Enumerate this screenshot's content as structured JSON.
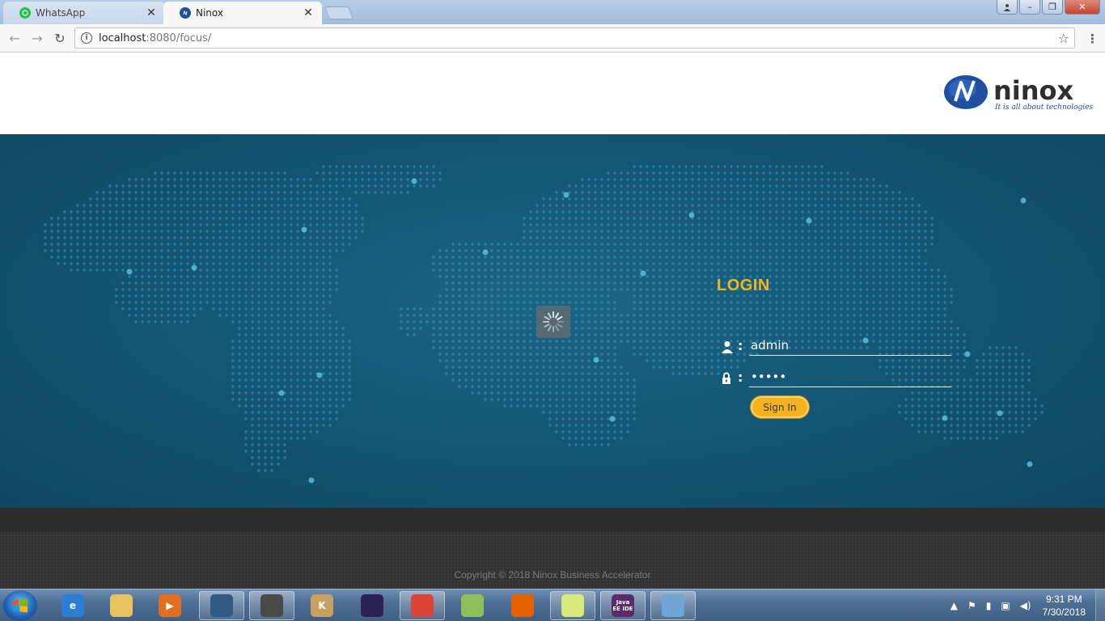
{
  "browser": {
    "tabs": [
      {
        "title": "WhatsApp",
        "active": false,
        "icon": "whatsapp-icon"
      },
      {
        "title": "Ninox",
        "active": true,
        "icon": "ninox-icon"
      }
    ],
    "url_host": "localhost",
    "url_rest": ":8080/focus/"
  },
  "brand": {
    "name": "ninox",
    "tagline": "It is all about technologies",
    "accent": "#f3b51d",
    "logo_blue": "#1f4f9e"
  },
  "login": {
    "title": "LOGIN",
    "username_value": "admin",
    "password_value": "admin",
    "signin_label": "Sign In"
  },
  "footer": {
    "copyright": "Copyright © 2018 Ninox Business Accelerator"
  },
  "taskbar": {
    "apps": [
      {
        "name": "ie-icon",
        "label": "e",
        "color": "#2a7fd4",
        "open": false
      },
      {
        "name": "explorer-icon",
        "label": "",
        "color": "#e6c35c",
        "open": false
      },
      {
        "name": "media-player-icon",
        "label": "▶",
        "color": "#e07020",
        "open": false
      },
      {
        "name": "mysql-workbench-icon",
        "label": "",
        "color": "#2f5a86",
        "open": true
      },
      {
        "name": "media-app-icon",
        "label": "",
        "color": "#4a4a4a",
        "open": true
      },
      {
        "name": "k-app-icon",
        "label": "K",
        "color": "#c8a060",
        "open": false
      },
      {
        "name": "eclipse-icon",
        "label": "",
        "color": "#2c2255",
        "open": false
      },
      {
        "name": "chrome-icon",
        "label": "",
        "color": "#db4437",
        "open": true
      },
      {
        "name": "notepad-plus-icon",
        "label": "",
        "color": "#8dbf5a",
        "open": false
      },
      {
        "name": "firefox-icon",
        "label": "",
        "color": "#e66000",
        "open": false
      },
      {
        "name": "sticky-notes-icon",
        "label": "",
        "color": "#d8e87a",
        "open": true
      },
      {
        "name": "javaee-ide-icon",
        "label": "Java EE IDE",
        "color": "#5a2a6a",
        "open": true
      },
      {
        "name": "paint-icon",
        "label": "",
        "color": "#6fa6d6",
        "open": true
      }
    ],
    "time": "9:31 PM",
    "date": "7/30/2018"
  }
}
